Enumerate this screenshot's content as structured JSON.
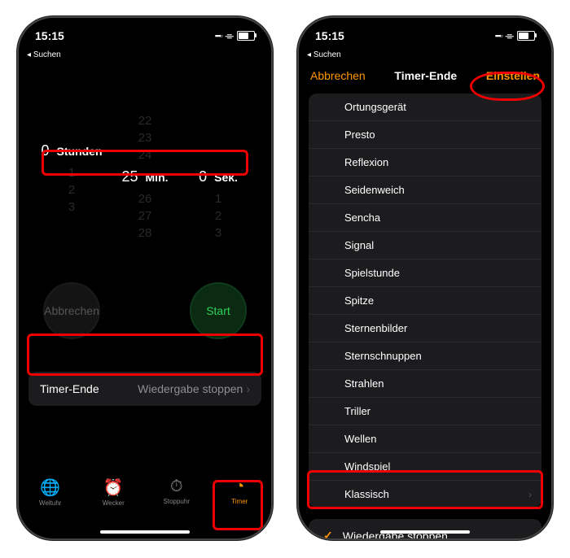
{
  "status": {
    "time": "15:15",
    "breadcrumb": "Suchen"
  },
  "timer": {
    "hours": {
      "value": "0",
      "label": "Stunden",
      "around": [
        "",
        ""
      ]
    },
    "minutes": {
      "value": "25",
      "label": "Min.",
      "around_before": [
        "22",
        "23",
        "24"
      ],
      "around_after": [
        "26",
        "27",
        "28"
      ]
    },
    "seconds": {
      "value": "0",
      "label": "Sek.",
      "around_before": [
        "",
        "",
        ""
      ],
      "around_after": [
        "1",
        "2",
        "3"
      ]
    },
    "cancel": "Abbrechen",
    "start": "Start",
    "end_label": "Timer-Ende",
    "end_value": "Wiedergabe stoppen"
  },
  "tabs": {
    "world": "Weltuhr",
    "alarm": "Wecker",
    "stop": "Stoppuhr",
    "timer": "Timer"
  },
  "picker_nav": {
    "cancel": "Abbrechen",
    "title": "Timer-Ende",
    "set": "Einstellen"
  },
  "sounds": [
    "Ortungsgerät",
    "Presto",
    "Reflexion",
    "Seidenweich",
    "Sencha",
    "Signal",
    "Spielstunde",
    "Spitze",
    "Sternenbilder",
    "Sternschnuppen",
    "Strahlen",
    "Triller",
    "Wellen",
    "Windspiel"
  ],
  "classic": "Klassisch",
  "stop_playback": "Wiedergabe stoppen"
}
